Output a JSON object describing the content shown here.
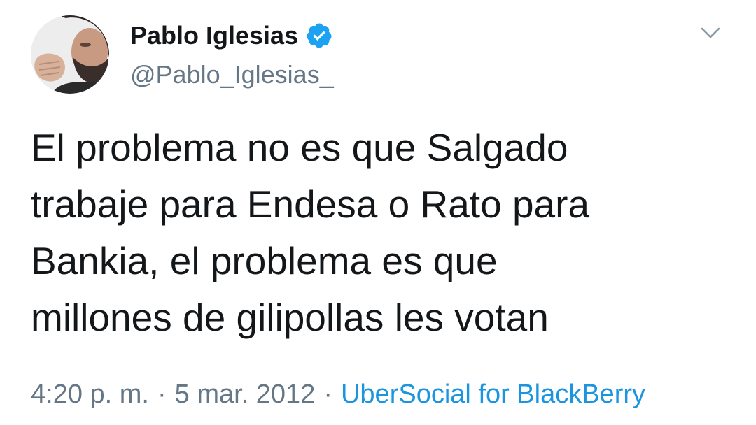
{
  "user": {
    "display_name": "Pablo Iglesias",
    "handle": "@Pablo_Iglesias_",
    "verified": true,
    "avatar_icon": "profile-photo"
  },
  "tweet": {
    "text": "El problema no es que Salgado\ntrabaje para Endesa o Rato para\nBankia, el problema es que\nmillones de gilipollas les votan",
    "time": "4:20 p. m.",
    "date": "5 mar. 2012",
    "separator": "·",
    "source": "UberSocial for BlackBerry"
  },
  "icons": {
    "verified": "verified-badge-icon",
    "menu": "chevron-down-icon"
  },
  "colors": {
    "text_primary": "#14171a",
    "text_secondary": "#657786",
    "link": "#1b95e0",
    "verified": "#1da1f2"
  }
}
